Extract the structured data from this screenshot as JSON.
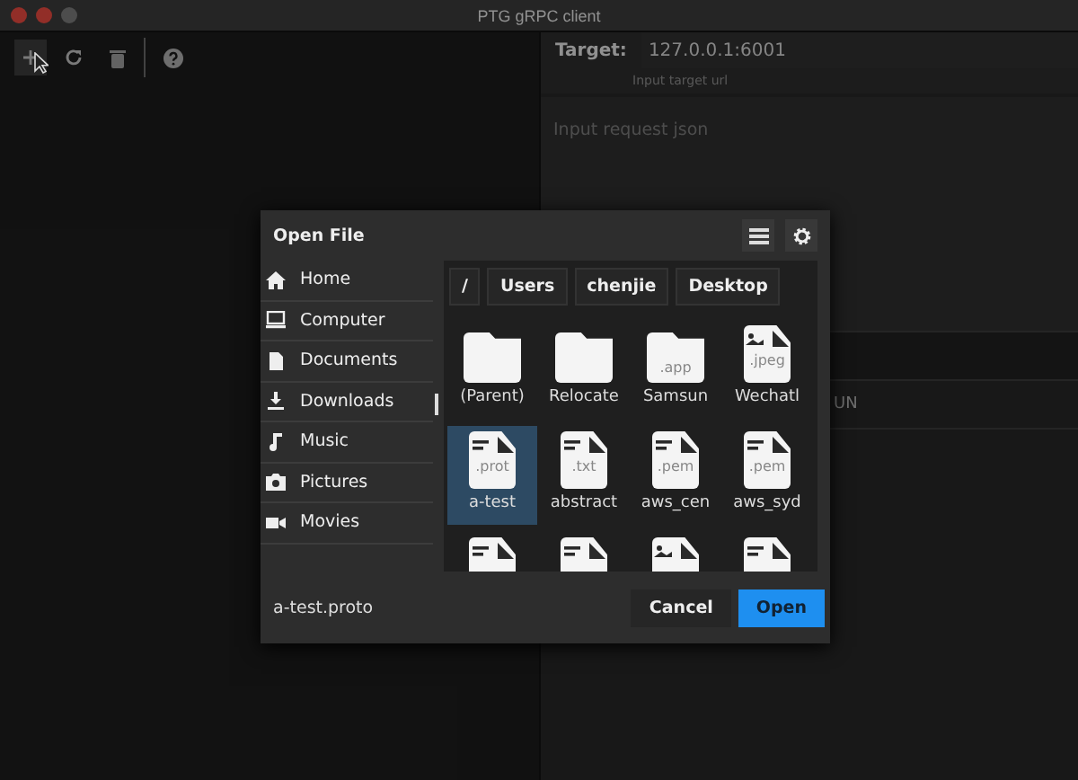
{
  "window": {
    "title": "PTG gRPC client"
  },
  "toolbar": {
    "buttons": [
      {
        "selected": true
      },
      {
        "selected": false
      },
      {
        "selected": false
      },
      {
        "selected": false
      }
    ]
  },
  "request": {
    "target_label": "Target:",
    "target_value": "127.0.0.1:6001",
    "target_hint": "Input target url",
    "body_placeholder": "Input request json",
    "run_label": "UN"
  },
  "dialog": {
    "title": "Open File",
    "places": [
      {
        "label": "Home"
      },
      {
        "label": "Computer"
      },
      {
        "label": "Documents"
      },
      {
        "label": "Downloads"
      },
      {
        "label": "Music"
      },
      {
        "label": "Pictures"
      },
      {
        "label": "Movies"
      }
    ],
    "path": [
      "/",
      "Users",
      "chenjie",
      "Desktop"
    ],
    "files": [
      {
        "kind": "folder",
        "name": "(Parent)",
        "selected": false
      },
      {
        "kind": "folder",
        "name": "Relocate",
        "selected": false
      },
      {
        "kind": "folder",
        "ext": ".app",
        "name": "Samsun",
        "selected": false
      },
      {
        "kind": "image",
        "ext": ".jpeg",
        "name": "Wechatl",
        "selected": false
      },
      {
        "kind": "file",
        "ext": ".prot",
        "name": "a-test",
        "selected": true
      },
      {
        "kind": "file",
        "ext": ".txt",
        "name": "abstract",
        "selected": false
      },
      {
        "kind": "file",
        "ext": ".pem",
        "name": "aws_cen",
        "selected": false
      },
      {
        "kind": "file",
        "ext": ".pem",
        "name": "aws_syd",
        "selected": false
      },
      {
        "kind": "file",
        "selected": false
      },
      {
        "kind": "file",
        "selected": false
      },
      {
        "kind": "image",
        "selected": false
      },
      {
        "kind": "file",
        "selected": false
      }
    ],
    "filename": "a-test.proto",
    "buttons": [
      {
        "label": "Cancel",
        "kind": "secondary"
      },
      {
        "label": "Open",
        "kind": "primary"
      }
    ]
  }
}
